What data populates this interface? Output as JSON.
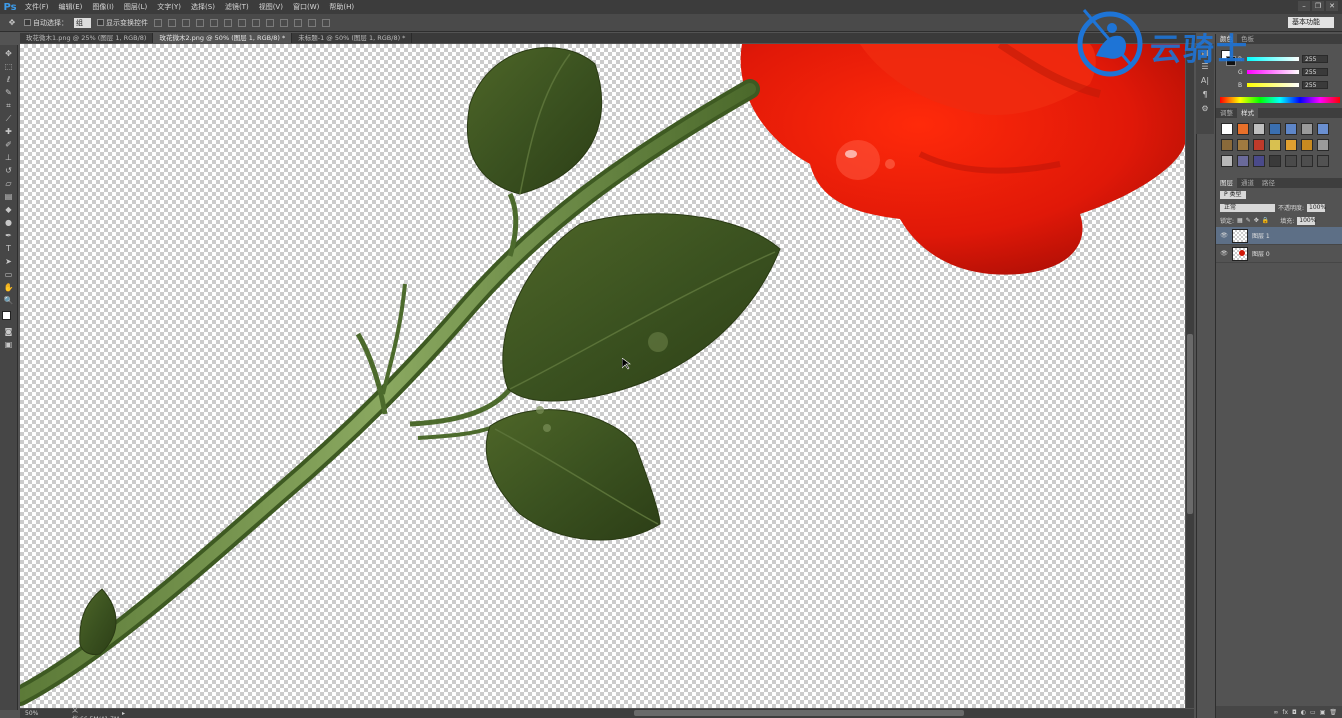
{
  "app": {
    "logo": "Ps",
    "menu": [
      "文件(F)",
      "编辑(E)",
      "图像(I)",
      "图层(L)",
      "文字(Y)",
      "选择(S)",
      "滤镜(T)",
      "视图(V)",
      "窗口(W)",
      "帮助(H)"
    ],
    "window_controls": [
      "–",
      "❐",
      "✕"
    ]
  },
  "options": {
    "auto_select_label": "自动选择：",
    "auto_select_value": "组",
    "transform_controls_label": "显示变换控件",
    "workspace": "基本功能"
  },
  "tabs": [
    {
      "label": "玫花微木1.png @ 25% (图层 1, RGB/8)",
      "active": false
    },
    {
      "label": "玫花微木2.png @ 50% (图层 1, RGB/8) *",
      "active": true
    },
    {
      "label": "未标题-1 @ 50% (图层 1, RGB/8) *",
      "active": false
    }
  ],
  "status": {
    "zoom": "50%",
    "doc_size": "文档:66.5M/41.7M",
    "arrow": "▸"
  },
  "color_panel": {
    "tabs": [
      "颜色",
      "色板"
    ],
    "channels": [
      {
        "label": "R",
        "value": "255"
      },
      {
        "label": "G",
        "value": "255"
      },
      {
        "label": "B",
        "value": "255"
      }
    ]
  },
  "styles_panel": {
    "tabs": [
      "调整",
      "样式"
    ],
    "swatches": [
      "#ffffff",
      "#e8702a",
      "#c0c0c0",
      "#3a6fb0",
      "#5e86c8",
      "#9a9a9a",
      "#6a8fd0",
      "#8a6a3a",
      "#a07a40",
      "#c03a2a",
      "#d8c050",
      "#e0a030",
      "#c88a20",
      "#9a9a9a",
      "#b8b8b8",
      "#6a6a9a",
      "#4a4a8a",
      "#3a3a3a",
      "#4a4a4a",
      "#4e4e4e",
      "#525252"
    ]
  },
  "layers_panel": {
    "tabs": [
      "图层",
      "通道",
      "路径"
    ],
    "filter": "P 类型",
    "blend_mode": "正常",
    "opacity_label": "不透明度:",
    "opacity_value": "100%",
    "lock_label": "锁定:",
    "fill_label": "填充:",
    "fill_value": "100%",
    "layers": [
      {
        "name": "图层 1",
        "visible": true,
        "selected": true
      },
      {
        "name": "图层 0",
        "visible": true,
        "selected": false
      }
    ],
    "footer_icons": [
      "∞",
      "fx",
      "◘",
      "◐",
      "▭",
      "▣",
      "🗑"
    ]
  },
  "watermark": {
    "text": "云骑士"
  }
}
